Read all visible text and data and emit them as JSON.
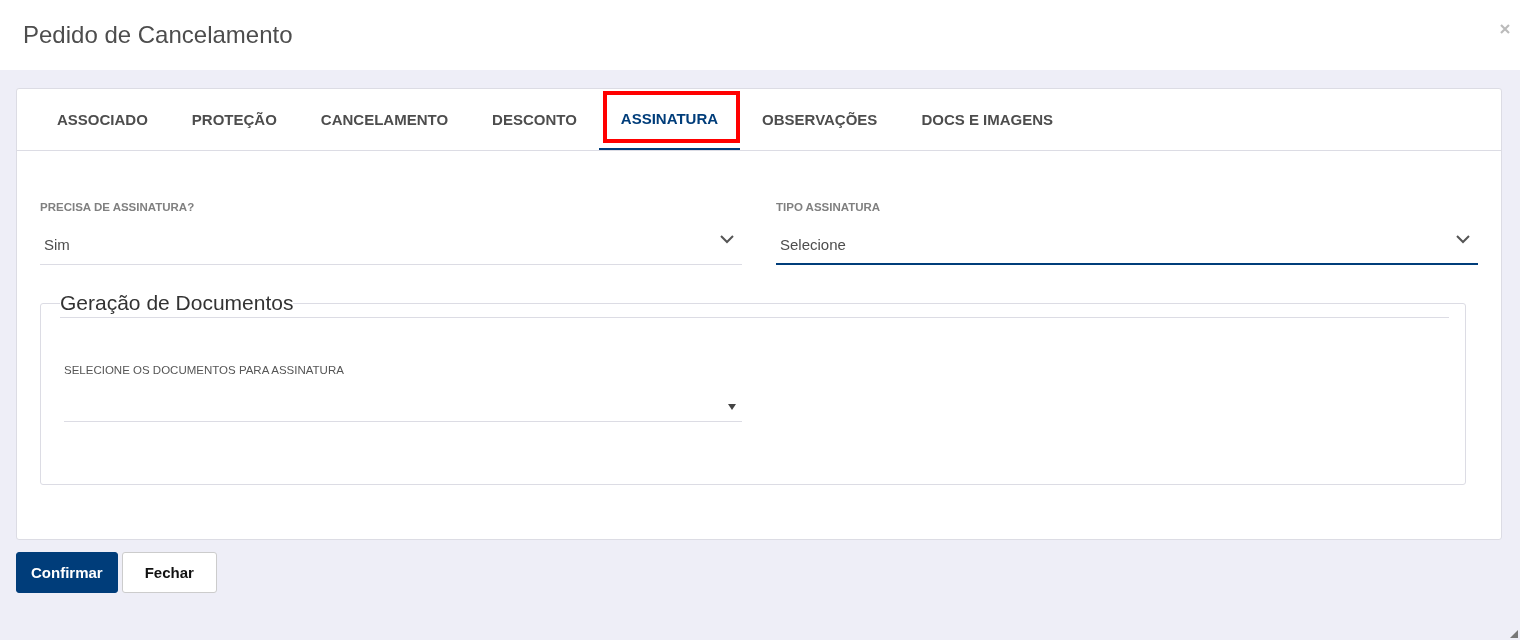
{
  "dialog": {
    "title": "Pedido de Cancelamento"
  },
  "tabs": [
    {
      "label": "ASSOCIADO",
      "selected": false,
      "highlighted": false
    },
    {
      "label": "PROTEÇÃO",
      "selected": false,
      "highlighted": false
    },
    {
      "label": "CANCELAMENTO",
      "selected": false,
      "highlighted": false
    },
    {
      "label": "DESCONTO",
      "selected": false,
      "highlighted": false
    },
    {
      "label": "ASSINATURA",
      "selected": true,
      "highlighted": true
    },
    {
      "label": "OBSERVAÇÕES",
      "selected": false,
      "highlighted": false
    },
    {
      "label": "DOCS E IMAGENS",
      "selected": false,
      "highlighted": false
    }
  ],
  "fields": [
    {
      "label": "PRECISA DE ASSINATURA?",
      "value": "Sim",
      "focused": false
    },
    {
      "label": "TIPO ASSINATURA",
      "value": "Selecione",
      "focused": true
    }
  ],
  "documents": {
    "legend": "Geração de Documentos",
    "label": "SELECIONE OS DOCUMENTOS PARA ASSINATURA"
  },
  "buttons": [
    {
      "label": "Confirmar",
      "kind": "primary"
    },
    {
      "label": "Fechar",
      "kind": "secondary"
    }
  ]
}
